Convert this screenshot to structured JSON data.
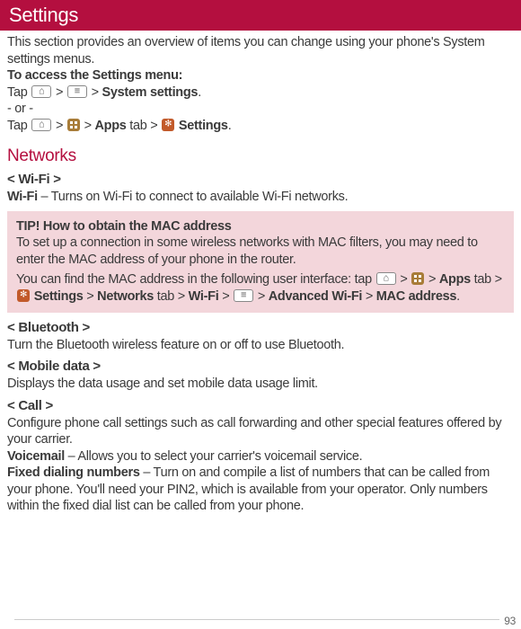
{
  "banner": {
    "title": "Settings"
  },
  "intro": {
    "p1": "This section provides an overview of items you can change using your phone's System settings menus.",
    "p2": "To access the Settings menu:",
    "nav1_pre": "Tap ",
    "nav1_mid": " > ",
    "nav1_mid2": " > ",
    "nav1_bold": "System settings",
    "nav1_end": ".",
    "or": "- or -",
    "nav2_pre": "Tap ",
    "nav2_m1": " > ",
    "nav2_m2": " > ",
    "nav2_apps": "Apps",
    "nav2_tab": " tab > ",
    "nav2_settings": " Settings",
    "nav2_end": "."
  },
  "networks": {
    "title": "Networks",
    "wifi_head": "< Wi-Fi >",
    "wifi_label": "Wi-Fi",
    "wifi_desc": " – Turns on Wi-Fi to connect to available Wi-Fi networks.",
    "tip": {
      "title": "TIP! How to obtain the MAC address",
      "p1": "To set up a connection in some wireless networks with MAC filters, you may need to enter the MAC address of your phone in the router.",
      "p2a": "You can find the MAC address in the following user interface: tap ",
      "p2b": " > ",
      "p2c": " > ",
      "apps": "Apps",
      "tab": " tab > ",
      "settings": " Settings",
      "g1": " > ",
      "networks": "Networks",
      "tab2": " tab > ",
      "wifi": "Wi-Fi",
      "g2": " > ",
      "g3": " > ",
      "adv": "Advanced Wi-Fi",
      "g4": " > ",
      "mac": "MAC address",
      "dot": "."
    },
    "bt_head": "< Bluetooth >",
    "bt_desc": "Turn the Bluetooth wireless feature on or off to use Bluetooth.",
    "md_head": "< Mobile data >",
    "md_desc": "Displays the data usage and set mobile data usage limit.",
    "call_head": "< Call >",
    "call_desc": "Configure phone call settings such as call forwarding and other special features offered by your carrier.",
    "vm_label": "Voicemail",
    "vm_desc": " – Allows you to select your carrier's voicemail service.",
    "fdn_label": "Fixed dialing numbers",
    "fdn_desc": " – Turn on and compile a list of numbers that can be called from your phone. You'll need your PIN2, which is available from your operator. Only numbers within the fixed dial list can be called from your phone."
  },
  "page": "93"
}
